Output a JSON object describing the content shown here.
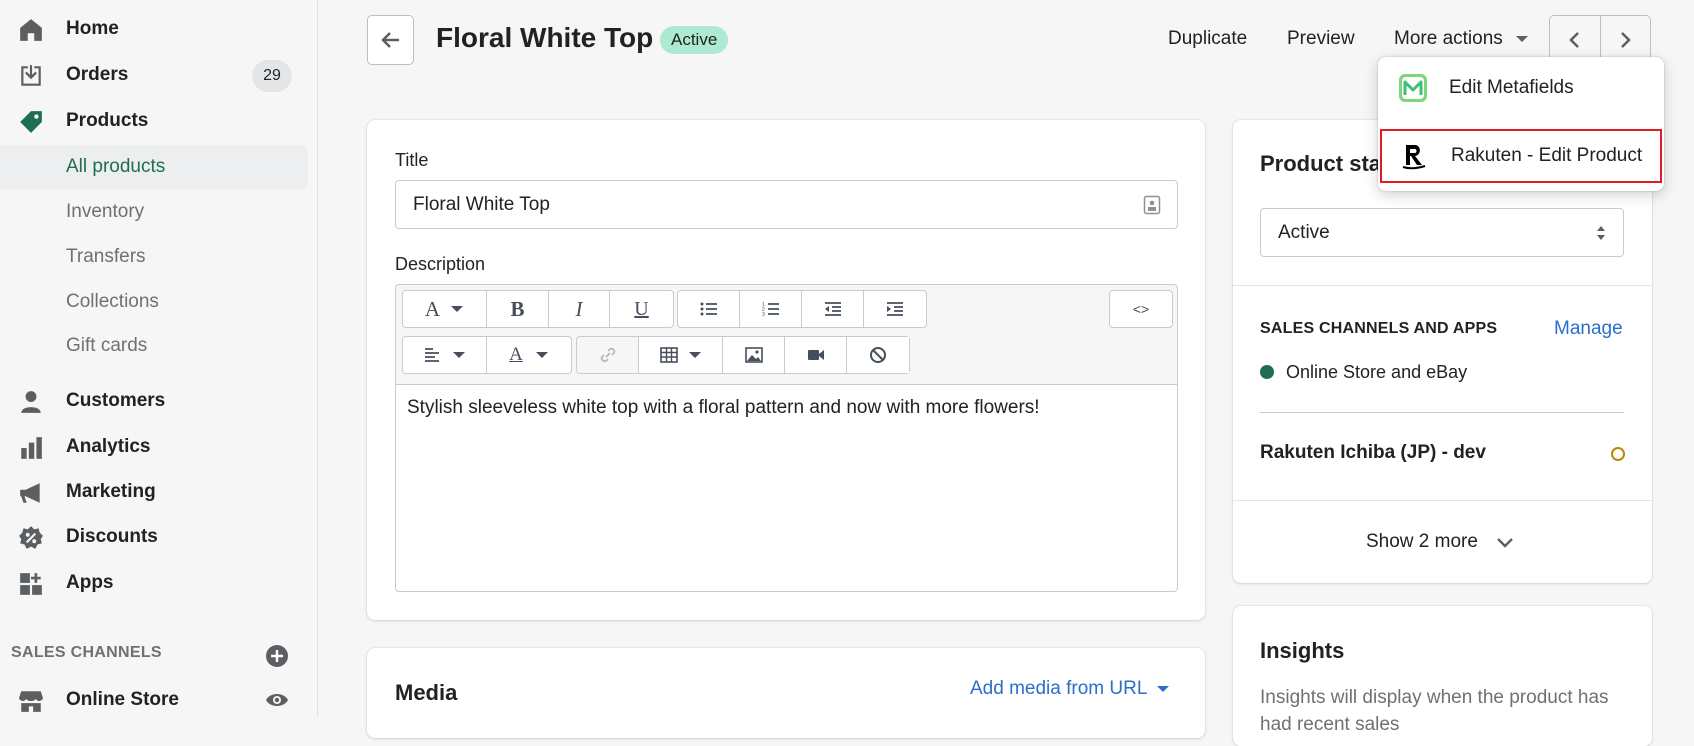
{
  "sidebar": {
    "home": "Home",
    "orders": "Orders",
    "orders_badge": "29",
    "products": "Products",
    "products_sub": [
      "All products",
      "Inventory",
      "Transfers",
      "Collections",
      "Gift cards"
    ],
    "customers": "Customers",
    "analytics": "Analytics",
    "marketing": "Marketing",
    "discounts": "Discounts",
    "apps": "Apps",
    "sales_channels_label": "SALES CHANNELS",
    "online_store": "Online Store"
  },
  "header": {
    "title": "Floral White Top",
    "status": "Active",
    "duplicate": "Duplicate",
    "preview": "Preview",
    "more_actions": "More actions"
  },
  "more_actions_menu": {
    "items": [
      "Edit Metafields",
      "Rakuten - Edit Product"
    ]
  },
  "product_form": {
    "title_label": "Title",
    "title_value": "Floral White Top",
    "description_label": "Description",
    "description_text": "Stylish sleeveless white top with a floral pattern and now with more flowers!",
    "toolbar": {
      "bold": "B",
      "italic": "I",
      "underline": "U",
      "html": "<>"
    }
  },
  "media": {
    "title": "Media",
    "add_media_url": "Add media from URL"
  },
  "product_status": {
    "title": "Product status",
    "select_value": "Active",
    "sales_channels_label": "SALES CHANNELS AND APPS",
    "manage": "Manage",
    "channel_1": "Online Store and eBay",
    "channel_2": "Rakuten Ichiba (JP) - dev",
    "show_more": "Show 2 more"
  },
  "insights": {
    "title": "Insights",
    "text": "Insights will display when the product has had recent sales"
  },
  "colors": {
    "accent_green": "#1f6e53",
    "active_pill": "#aee9d1",
    "link_blue": "#2c6ecb",
    "highlight_red": "#e01b24"
  }
}
